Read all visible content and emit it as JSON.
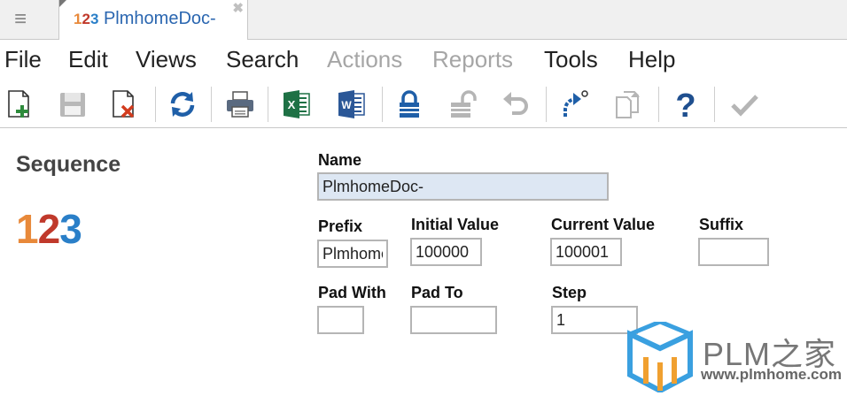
{
  "tab": {
    "logo_1": "1",
    "logo_2": "2",
    "logo_3": "3",
    "title": "PlmhomeDoc-",
    "close_symbol": "✖"
  },
  "menu": [
    {
      "label": "File",
      "enabled": true
    },
    {
      "label": "Edit",
      "enabled": true
    },
    {
      "label": "Views",
      "enabled": true
    },
    {
      "label": "Search",
      "enabled": true
    },
    {
      "label": "Actions",
      "enabled": false
    },
    {
      "label": "Reports",
      "enabled": false
    },
    {
      "label": "Tools",
      "enabled": true
    },
    {
      "label": "Help",
      "enabled": true
    }
  ],
  "toolbar": {
    "icons": [
      "new-item-icon",
      "save-icon",
      "delete-icon",
      "refresh-icon",
      "print-icon",
      "excel-icon",
      "word-icon",
      "lock-icon",
      "unlock-icon",
      "undo-icon",
      "promote-icon",
      "copy-icon",
      "help-icon",
      "check-icon"
    ],
    "excel_letter": "X",
    "word_letter": "W",
    "help_symbol": "?"
  },
  "item_type": {
    "label": "Sequence",
    "logo_1": "1",
    "logo_2": "2",
    "logo_3": "3"
  },
  "form": {
    "name": {
      "label": "Name",
      "value": "PlmhomeDoc-"
    },
    "prefix": {
      "label": "Prefix",
      "value": "PlmhomeDoc-"
    },
    "initial_value": {
      "label": "Initial Value",
      "value": "100000"
    },
    "current_value": {
      "label": "Current Value",
      "value": "100001"
    },
    "suffix": {
      "label": "Suffix",
      "value": ""
    },
    "pad_with": {
      "label": "Pad With",
      "value": ""
    },
    "pad_to": {
      "label": "Pad To",
      "value": ""
    },
    "step": {
      "label": "Step",
      "value": "1"
    }
  },
  "watermark": {
    "brand": "PLM之家",
    "url": "www.plmhome.com"
  },
  "colors": {
    "logo_orange": "#e8893a",
    "logo_red": "#c0392b",
    "logo_blue": "#2a7fc8",
    "toolbar_blue": "#1f5fa8",
    "excel_green": "#1e7145",
    "word_blue": "#2b5797",
    "delete_red": "#d23c1e",
    "disabled_gray": "#a6a6a6"
  }
}
